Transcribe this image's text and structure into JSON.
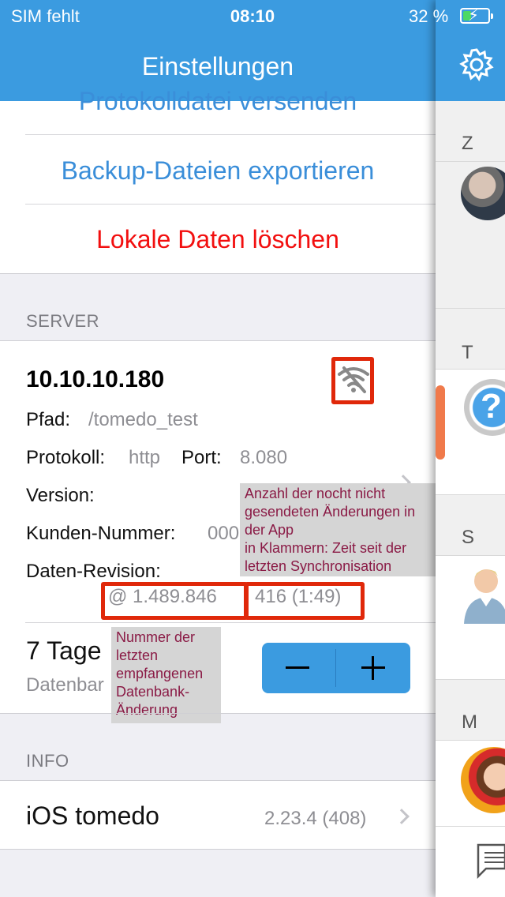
{
  "status_bar": {
    "carrier": "SIM fehlt",
    "time": "08:10",
    "battery_percent": "32 %",
    "battery_level": 0.32,
    "battery_color": "#4cd964"
  },
  "nav": {
    "title": "Einstellungen"
  },
  "actions": {
    "send_log": "Protokolldatei versenden",
    "export_backup": "Backup-Dateien exportieren",
    "delete_local": "Lokale Daten löschen"
  },
  "server": {
    "header": "SERVER",
    "ip": "10.10.10.180",
    "status_icon": "wifi-off-icon",
    "path_label": "Pfad:",
    "path_value": "/tomedo_test",
    "protocol_label": "Protokoll:",
    "protocol_value": "http",
    "port_label": "Port:",
    "port_value": "8.080",
    "version_label": "Version:",
    "customer_label": "Kunden-Nummer:",
    "customer_value": "000",
    "revision_label": "Daten-Revision:",
    "revision_value": "@ 1.489.846",
    "pending_value": "416 (1:49)"
  },
  "retention": {
    "title": "7 Tage",
    "subtitle": "Datenbar"
  },
  "info": {
    "header": "INFO",
    "app_name": "iOS tomedo",
    "app_version": "2.23.4 (408)"
  },
  "annotations": {
    "pending_note": [
      "Anzahl der nocht nicht",
      "gesendeten Änderungen in",
      "der App",
      "in Klammern: Zeit seit der",
      "letzten Synchronisation"
    ],
    "revision_note": [
      "Nummer der",
      "letzten",
      "empfangenen",
      "Datenbank-",
      "Änderung"
    ]
  },
  "sidebar": {
    "letters": [
      "Z",
      "T",
      "S",
      "M"
    ]
  },
  "colors": {
    "accent": "#3b9be0",
    "link": "#3a8ed9",
    "destructive": "#f20f0f",
    "annotation_border": "#e0280a"
  }
}
